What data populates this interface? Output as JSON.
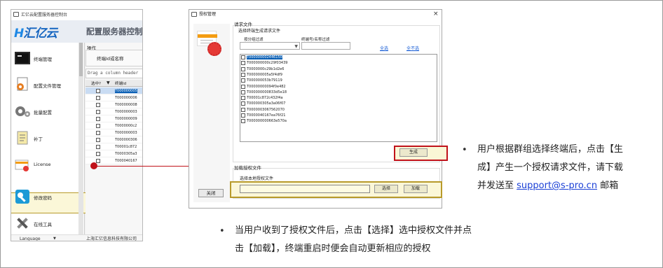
{
  "app": {
    "window_title": "汇亿云配置服务器控制台",
    "logo": "汇亿云",
    "banner_title": "配置服务器控制",
    "nav": [
      {
        "label": "终端管理"
      },
      {
        "label": "配置文件管理"
      },
      {
        "label": "批量配置"
      },
      {
        "label": "补丁"
      },
      {
        "label": "License"
      },
      {
        "label": "修改密码"
      },
      {
        "label": "在线工具"
      }
    ],
    "language": "Language",
    "company": "上海汇亿信息科技有限公司",
    "operation_label": "操作",
    "operation_field": "终端Id或名称",
    "drag_hint": "Drag a column header",
    "grid_headers": {
      "selected": "选中?",
      "id": "终端Id"
    },
    "grid_rows": [
      "T000000005",
      "T000000006",
      "T000000008",
      "T000000003",
      "T000000009",
      "T0000000c2",
      "T000000003",
      "T000000306",
      "T00001c872",
      "T0000305a3",
      "T000040167"
    ]
  },
  "dialog": {
    "title": "授权管理",
    "close_x": "×",
    "group_request": "请求文件",
    "sub_label": "选择终端生成请求文件",
    "filter_group_label": "按分组过滤",
    "filter_text_label": "终端号/名称过滤",
    "select_all": "全选",
    "select_none": "全不选",
    "terminals": [
      "T000000002446150",
      "T000000000c29f03439",
      "T0000000c29b1d2e6",
      "T000000005a5f4df9",
      "T000000053b79119",
      "T00000000094f0e482",
      "T000000000833d5e18",
      "T00001c872c432f4a",
      "T000000305a3a06f07",
      "T0000003067562070",
      "T0000040167ea76f21",
      "T000000000663e570a"
    ],
    "generate_button": "生成",
    "group_load": "加载授权文件",
    "file_label": "选择本地授权文件",
    "select_button": "选择",
    "load_button": "加载",
    "close_button": "关闭"
  },
  "notes": {
    "note1_line1": "用户根据群组选择终端后，点击【生",
    "note1_line2": "成】产生一个授权请求文件，请下载",
    "note1_line3_pre": "并发送至 ",
    "note1_email": "support@s-pro.cn",
    "note1_line3_post": " 邮箱",
    "note2_line1": "当用户收到了授权文件后，点击【选择】选中授权文件并点",
    "note2_line2": "击【加载】，终端重启时便会自动更新相应的授权"
  },
  "colors": {
    "accent": "#c0121a",
    "highlight_border": "#b89a2a",
    "selection": "#0a5fb4",
    "link": "#1a3fd6"
  }
}
